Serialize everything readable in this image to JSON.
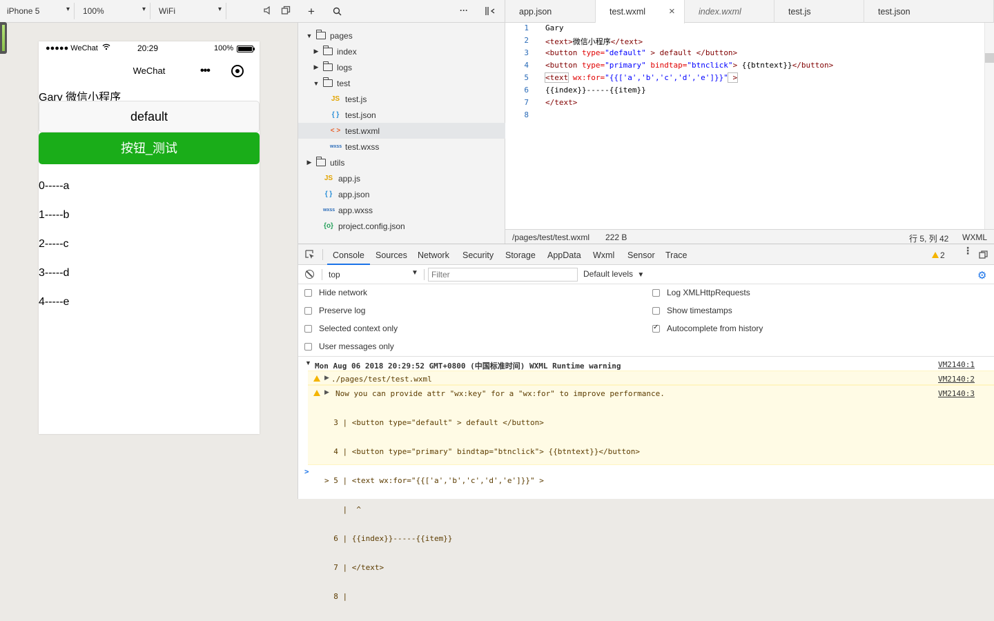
{
  "simulator": {
    "device": "iPhone 5",
    "zoom": "100%",
    "network": "WiFi",
    "status": {
      "carrier": "●●●●● WeChat",
      "time": "20:29",
      "battery": "100%"
    },
    "nav_title": "WeChat",
    "page": {
      "text_line": "Gary 微信小程序",
      "default_button": "default",
      "primary_button": "按钮_测试",
      "list": [
        "0-----a",
        "1-----b",
        "2-----c",
        "3-----d",
        "4-----e"
      ]
    }
  },
  "tree": {
    "items": [
      {
        "label": "pages",
        "type": "folder-open"
      },
      {
        "label": "index",
        "type": "folder"
      },
      {
        "label": "logs",
        "type": "folder"
      },
      {
        "label": "test",
        "type": "folder-open"
      },
      {
        "label": "test.js",
        "type": "js",
        "glyph": "JS"
      },
      {
        "label": "test.json",
        "type": "json",
        "glyph": "{ }"
      },
      {
        "label": "test.wxml",
        "type": "wxml",
        "glyph": "< >"
      },
      {
        "label": "test.wxss",
        "type": "wxss",
        "glyph": "wxss"
      },
      {
        "label": "utils",
        "type": "folder"
      },
      {
        "label": "app.js",
        "type": "js",
        "glyph": "JS"
      },
      {
        "label": "app.json",
        "type": "json",
        "glyph": "{ }"
      },
      {
        "label": "app.wxss",
        "type": "wxss",
        "glyph": "wxss"
      },
      {
        "label": "project.config.json",
        "type": "config",
        "glyph": "{o}"
      }
    ]
  },
  "editor": {
    "tabs": [
      "app.json",
      "test.wxml",
      "index.wxml",
      "test.js",
      "test.json"
    ],
    "active_tab": "test.wxml",
    "close_glyph": "×",
    "lines": [
      "1",
      "2",
      "3",
      "4",
      "5",
      "6",
      "7",
      "8"
    ],
    "code": {
      "l1": "Gary",
      "l2_open": "<text>",
      "l2_txt": "微信小程序",
      "l2_close": "</text>",
      "l3_tag": "<button",
      "l3_attr": " type=",
      "l3_str": "\"default\"",
      "l3_rest": " > default ",
      "l3_close": "</button>",
      "l4_tag": "<button",
      "l4_attr1": " type=",
      "l4_str1": "\"primary\"",
      "l4_attr2": " bindtap=",
      "l4_str2": "\"btnclick\"",
      "l4_gt": ">",
      "l4_rest": " {{btntext}}",
      "l4_close": "</button>",
      "l5_tag": "<text",
      "l5_attr": " wx:for=",
      "l5_str": "\"{{['a','b','c','d','e']}}\"",
      "l5_gt": " >",
      "l6": "{{index}}-----{{item}}",
      "l7": "</text>"
    },
    "status": {
      "path": "/pages/test/test.wxml",
      "size": "222 B",
      "cursor": "行 5, 列 42",
      "lang": "WXML"
    }
  },
  "devtools": {
    "tabs": [
      "Console",
      "Sources",
      "Network",
      "Security",
      "Storage",
      "AppData",
      "Wxml",
      "Sensor",
      "Trace"
    ],
    "warn_count": "2",
    "context": "top",
    "filter_placeholder": "Filter",
    "levels": "Default levels",
    "options_left": [
      "Hide network",
      "Preserve log",
      "Selected context only",
      "User messages only"
    ],
    "options_right": [
      "Log XMLHttpRequests",
      "Show timestamps",
      "Autocomplete from history"
    ],
    "autocomplete_checked": true,
    "messages": {
      "group_header": "Mon Aug 06 2018 20:29:52 GMT+0800 (中国标准时间) WXML Runtime warning",
      "group_link": "VM2140:1",
      "w1_text": "./pages/test/test.wxml",
      "w1_link": "VM2140:2",
      "w2_text": "Now you can provide attr \"wx:key\" for a \"wx:for\" to improve performance.",
      "w2_link": "VM2140:3",
      "snippet": [
        "  3 | <button type=\"default\" > default </button>",
        "  4 | <button type=\"primary\" bindtap=\"btnclick\"> {{btntext}}</button>",
        "> 5 | <text wx:for=\"{{['a','b','c','d','e']}}\" >",
        "    |  ^",
        "  6 | {{index}}-----{{item}}",
        "  7 | </text>",
        "  8 |"
      ],
      "prompt": ">"
    }
  }
}
